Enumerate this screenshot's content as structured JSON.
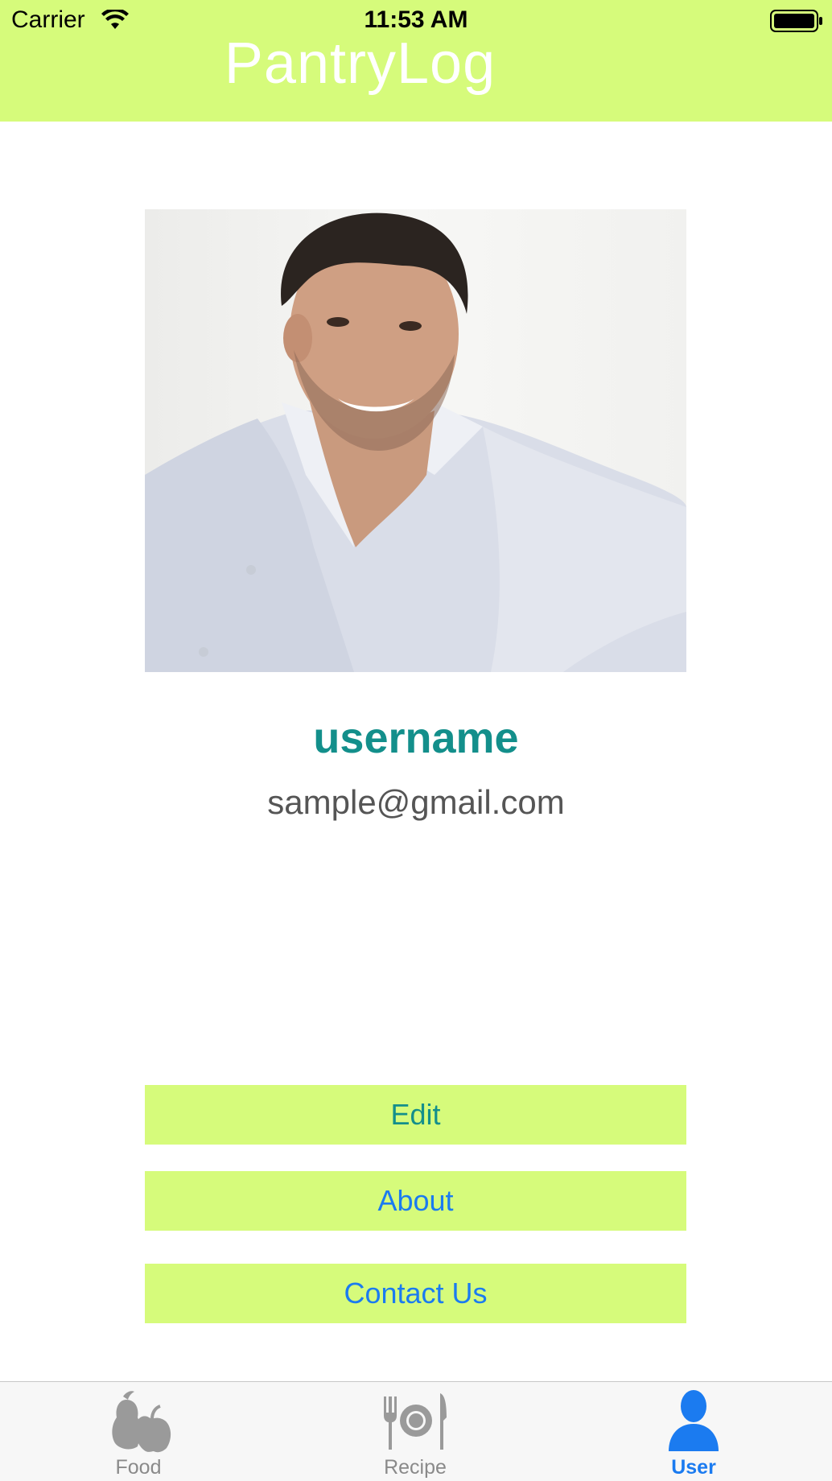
{
  "status_bar": {
    "carrier": "Carrier",
    "time": "11:53 AM"
  },
  "header": {
    "title": "PantryLog",
    "background_color": "#d6fb7b"
  },
  "profile": {
    "username": "username",
    "email": "sample@gmail.com"
  },
  "buttons": {
    "edit": "Edit",
    "about": "About",
    "contact": "Contact Us"
  },
  "tab_bar": {
    "tabs": [
      {
        "label": "Food",
        "icon": "food-icon",
        "active": false
      },
      {
        "label": "Recipe",
        "icon": "recipe-icon",
        "active": false
      },
      {
        "label": "User",
        "icon": "user-icon",
        "active": true
      }
    ]
  },
  "colors": {
    "accent": "#d6fb7b",
    "username": "#138f8b",
    "link_blue": "#1b7bf0"
  }
}
